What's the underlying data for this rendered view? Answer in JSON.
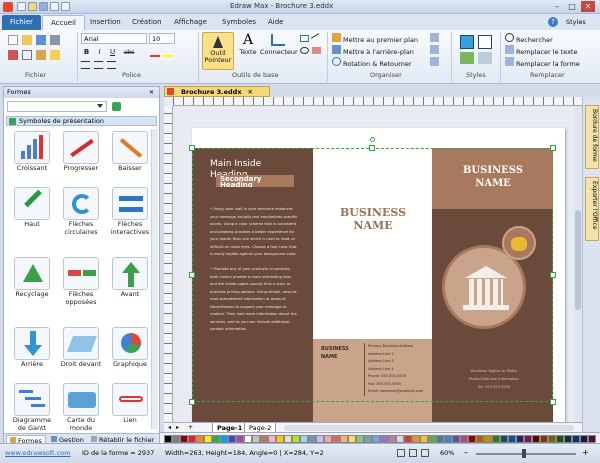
{
  "window": {
    "title": "Edraw Max - Brochure 3.eddx",
    "minimize": "–",
    "restore": "□",
    "close": "✕",
    "help_icon": "?",
    "styles_label": "Styles"
  },
  "tabs": [
    {
      "label": "Fichier"
    },
    {
      "label": "Accueil"
    },
    {
      "label": "Insertion"
    },
    {
      "label": "Création"
    },
    {
      "label": "Affichage"
    },
    {
      "label": "Symboles"
    },
    {
      "label": "Aide"
    }
  ],
  "ribbon": {
    "font_name": "Arial",
    "font_size": "10",
    "bold": "B",
    "italic": "I",
    "underline": "U",
    "strike": "abc",
    "groups": {
      "fichier": "Fichier",
      "police": "Police",
      "outils": "Outils de base",
      "organiser": "Organiser",
      "styles": "Styles",
      "remplacer": "Remplacer"
    },
    "tool_pointer": "Outil Pointeur",
    "tool_text": "Texte",
    "tool_connector": "Connecteur",
    "arrange": [
      "Mettre au premier plan",
      "Mettre à l'arrière-plan",
      "Rotation & Retourner"
    ],
    "find": [
      "Rechercher",
      "Remplacer le texte",
      "Remplacer la forme"
    ]
  },
  "panel": {
    "title": "Formes",
    "section": "Symboles de présentation",
    "symbols": [
      "Croissant",
      "Progresser",
      "Baisser",
      "Haut",
      "Flèches circulaires",
      "Flèches interactives",
      "Recyclage",
      "Flèches opposées",
      "Avant",
      "Arrière",
      "Droit devant",
      "Graphique",
      "Diagramme de Gantt",
      "Carte du monde",
      "Lien"
    ],
    "bottom_tabs": [
      "Formes",
      "Gestion",
      "Rétablir le fichier"
    ]
  },
  "document": {
    "tab_label": "Brochure 3.eddx",
    "main_heading": "Main Inside Heading",
    "secondary_heading": "Secondary Heading",
    "body_text": [
      "• Using color wall in your brochure enhances your message visually and emphasizes specific points. Using a color scheme that is consistent and pleasing provides a better experience for your reader than one which is hard to read, or difficult on most eyes. Choose a font color that is easily legible against your background color.",
      "• Promote any of your products or services, both covers provide a more interesting look, and the inside pages usually tells a story or provides pricing options. Using simple, easy-to-read spreadsheet information or areas of Nevertheless to support your message to readers. They hold more information about the services, and so you can include additional contact information."
    ],
    "business_name": "BUSINESS NAME",
    "mid_small_name": "BUSINESS NAME",
    "address_lines": [
      "Primary Business Address",
      "Address Line 2",
      "Address Line 3",
      "Address Line 4",
      "Phone: 555-555-5555",
      "Fax: 555-555-5555",
      "Email: someone@example.com"
    ],
    "right_title": "BUSINESS NAME",
    "right_footer": [
      "Business Tagline or Motto",
      "Product/Service Information",
      "Tel: 555 555 5555"
    ],
    "page_tabs": [
      "Page-1",
      "Page-2"
    ]
  },
  "rightbar": {
    "tab1": "Bordure de forme",
    "tab2": "Exporter l'Office"
  },
  "palette_colors": [
    "#000000",
    "#7f7f7f",
    "#880015",
    "#ed1c24",
    "#ff7f27",
    "#fff200",
    "#22b14c",
    "#00a2e8",
    "#3f48cc",
    "#a349a4",
    "#ffffff",
    "#c3c3c3",
    "#b97a57",
    "#ffaec9",
    "#ffc90e",
    "#efe4b0",
    "#b5e61d",
    "#99d9ea",
    "#7092be",
    "#c8bfe7",
    "#f4a6a6",
    "#e06666",
    "#f6b26b",
    "#ffd966",
    "#93c47d",
    "#76a5af",
    "#6fa8dc",
    "#8e7cc3",
    "#c27ba0",
    "#d9d9d9",
    "#cc4125",
    "#e69138",
    "#f1c232",
    "#6aa84f",
    "#45818e",
    "#3d85c6",
    "#674ea7",
    "#a64d79",
    "#990000",
    "#b45f06",
    "#bf9000",
    "#38761d",
    "#134f5c",
    "#0b5394",
    "#351c75",
    "#741b47",
    "#660000",
    "#783f04",
    "#7f6000",
    "#274e13",
    "#0c343d",
    "#073763",
    "#20124d",
    "#4c1130"
  ],
  "status": {
    "url": "www.edrawsoft.com",
    "shape_id": "ID de la forme = 2937",
    "dims": "Width=263, Height=184, Angle=0 | X=284, Y=2",
    "zoom": "60%"
  },
  "colors": {
    "brown": "#6a4a3a",
    "tan": "#a8795e",
    "cream": "#c9a48a",
    "accent": "#2f6db5"
  }
}
